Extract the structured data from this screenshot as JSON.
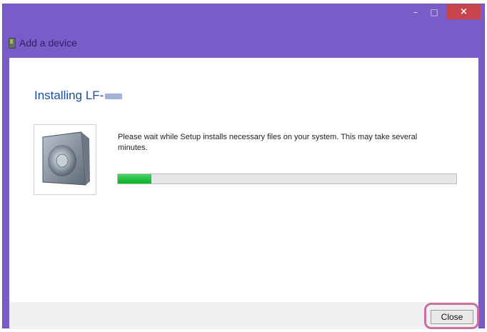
{
  "window": {
    "title": "Add a device",
    "controls": {
      "minimize": "–",
      "maximize": "□",
      "close": "×"
    }
  },
  "main": {
    "heading": "Installing LF-",
    "description": "Please wait while Setup installs necessary files on your system. This may take several minutes.",
    "progress": 0.1
  },
  "footer": {
    "close_label": "Close"
  },
  "icons": {
    "header": "device-icon",
    "thumbnail": "speaker-icon"
  },
  "colors": {
    "accent": "#7a5cc8",
    "heading": "#1f4e9c",
    "progress": "#06b025",
    "close_highlight": "#c9719d"
  }
}
